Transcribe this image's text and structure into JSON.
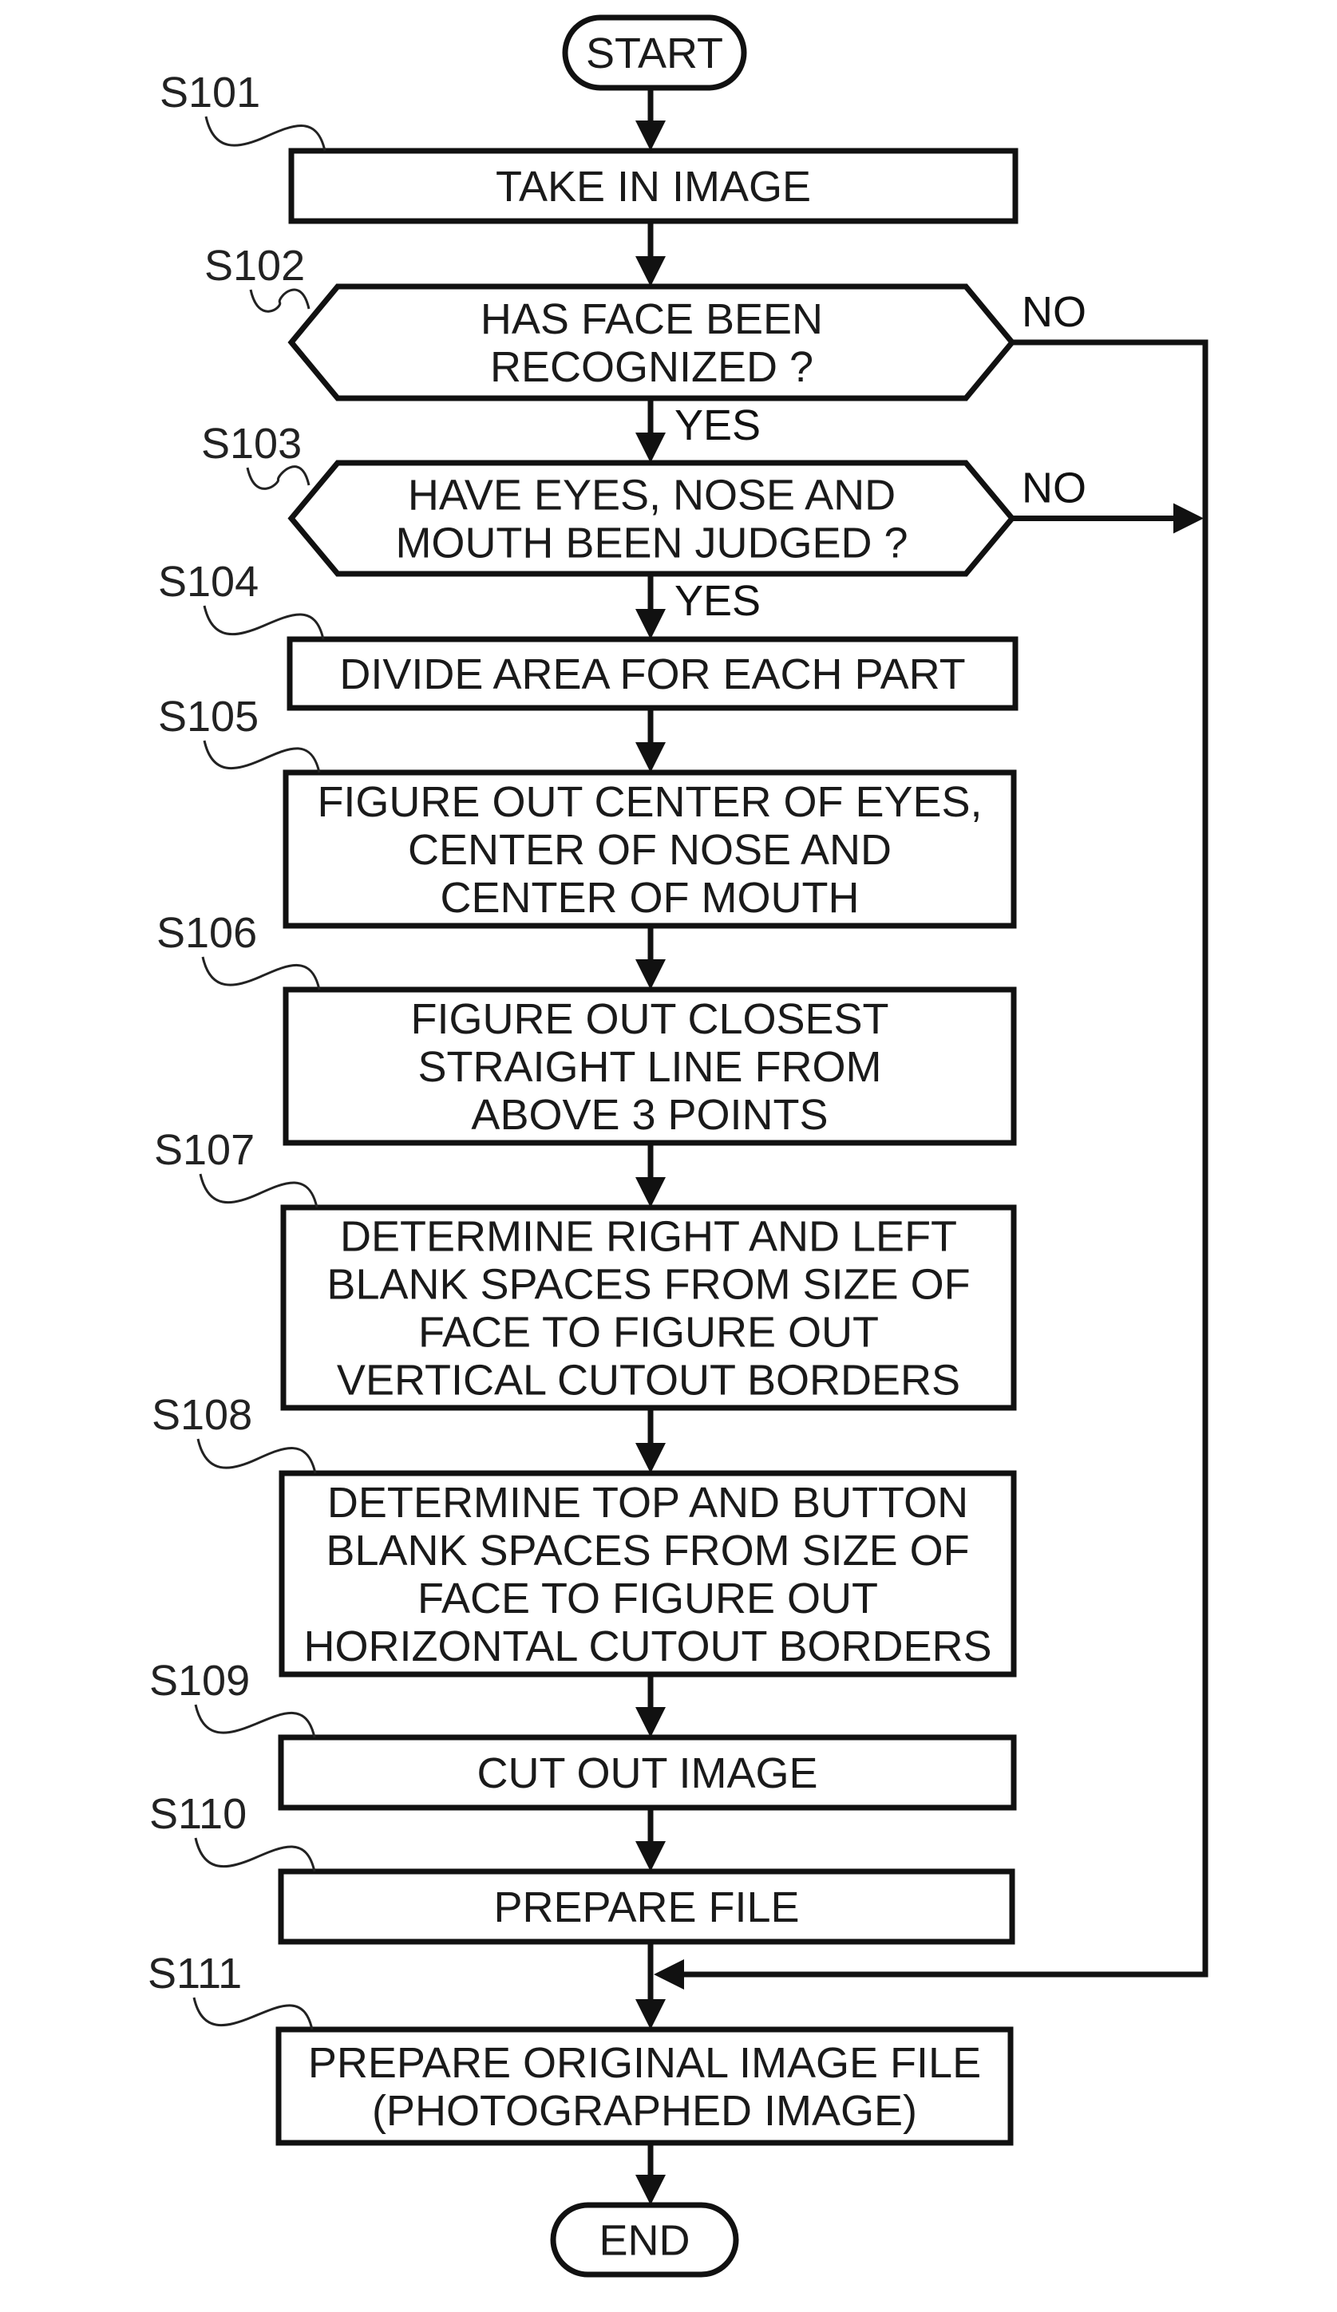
{
  "diagram": {
    "type": "flowchart",
    "terminals": {
      "start": "START",
      "end": "END"
    },
    "steps": [
      {
        "id": "S101",
        "kind": "process",
        "lines": [
          "TAKE IN IMAGE"
        ]
      },
      {
        "id": "S102",
        "kind": "decision",
        "lines": [
          "HAS FACE BEEN",
          "RECOGNIZED ?"
        ],
        "yes_label": "YES",
        "no_label": "NO"
      },
      {
        "id": "S103",
        "kind": "decision",
        "lines": [
          "HAVE EYES, NOSE AND",
          "MOUTH BEEN JUDGED ?"
        ],
        "yes_label": "YES",
        "no_label": "NO"
      },
      {
        "id": "S104",
        "kind": "process",
        "lines": [
          "DIVIDE AREA FOR EACH PART"
        ]
      },
      {
        "id": "S105",
        "kind": "process",
        "lines": [
          "FIGURE OUT CENTER OF EYES,",
          "CENTER OF NOSE AND",
          "CENTER OF MOUTH"
        ]
      },
      {
        "id": "S106",
        "kind": "process",
        "lines": [
          "FIGURE OUT CLOSEST",
          "STRAIGHT LINE FROM",
          "ABOVE 3 POINTS"
        ]
      },
      {
        "id": "S107",
        "kind": "process",
        "lines": [
          "DETERMINE RIGHT AND LEFT",
          "BLANK SPACES FROM SIZE OF",
          "FACE TO FIGURE OUT",
          "VERTICAL CUTOUT BORDERS"
        ]
      },
      {
        "id": "S108",
        "kind": "process",
        "lines": [
          "DETERMINE TOP AND BUTTON",
          "BLANK SPACES FROM SIZE OF",
          "FACE TO FIGURE OUT",
          "HORIZONTAL CUTOUT BORDERS"
        ]
      },
      {
        "id": "S109",
        "kind": "process",
        "lines": [
          "CUT OUT IMAGE"
        ]
      },
      {
        "id": "S110",
        "kind": "process",
        "lines": [
          "PREPARE FILE"
        ]
      },
      {
        "id": "S111",
        "kind": "process",
        "lines": [
          "PREPARE ORIGINAL IMAGE FILE",
          "(PHOTOGRAPHED IMAGE)"
        ]
      }
    ],
    "edges": [
      {
        "from": "START",
        "to": "S101"
      },
      {
        "from": "S101",
        "to": "S102"
      },
      {
        "from": "S102",
        "to": "S103",
        "label": "YES"
      },
      {
        "from": "S102",
        "to": "S111",
        "label": "NO"
      },
      {
        "from": "S103",
        "to": "S104",
        "label": "YES"
      },
      {
        "from": "S103",
        "to": "S111",
        "label": "NO"
      },
      {
        "from": "S104",
        "to": "S105"
      },
      {
        "from": "S105",
        "to": "S106"
      },
      {
        "from": "S106",
        "to": "S107"
      },
      {
        "from": "S107",
        "to": "S108"
      },
      {
        "from": "S108",
        "to": "S109"
      },
      {
        "from": "S109",
        "to": "S110"
      },
      {
        "from": "S110",
        "to": "S111"
      },
      {
        "from": "S111",
        "to": "END"
      }
    ],
    "colors": {
      "stroke": "#111111",
      "background": "#ffffff"
    }
  }
}
